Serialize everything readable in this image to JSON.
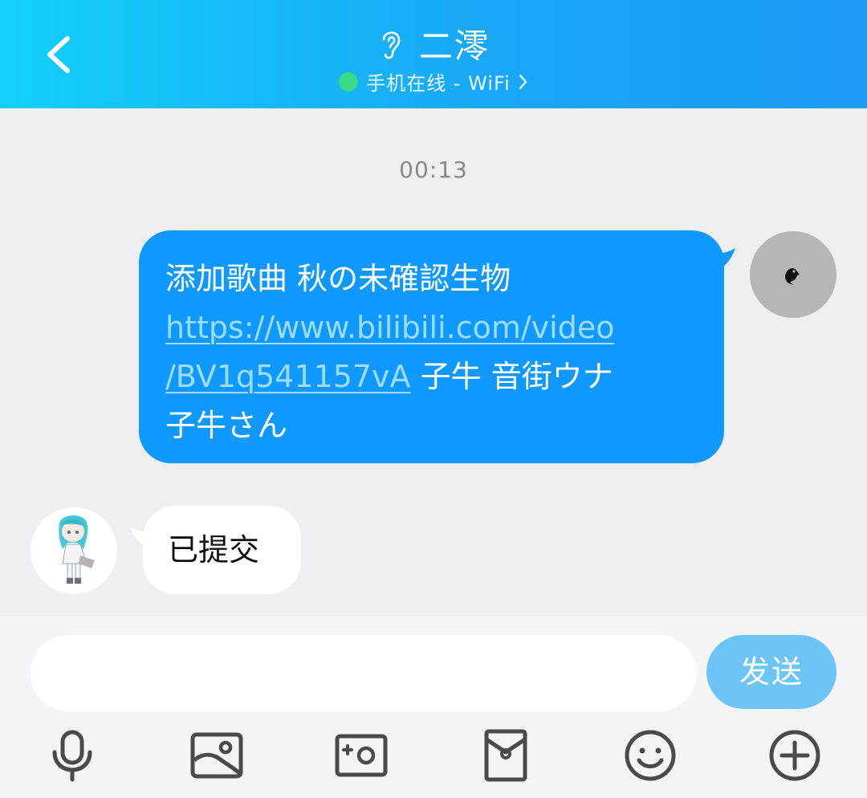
{
  "header": {
    "contact_name": "二澪",
    "status_text": "手机在线 - WiFi",
    "status_color": "#3bd98a",
    "accent": "#1a9bf6",
    "icons": [
      "back-arrow-icon",
      "ear-icon",
      "chevron-right-icon"
    ]
  },
  "chat": {
    "timestamp": "00:13",
    "messages": [
      {
        "sender": "self",
        "bubble_color": "#0f99ff",
        "text_before_link": "添加歌曲 秋の未確認生物",
        "link_line1": "https://www.bilibili.com/video",
        "link_line2": "/BV1q541157vA",
        "text_after_link": " 子牛 音街ウナ",
        "text_last_line": "子牛さん"
      },
      {
        "sender": "contact",
        "bubble_color": "#ffffff",
        "text": "已提交"
      }
    ]
  },
  "composer": {
    "input_value": "",
    "send_label": "发送",
    "send_color": "#6cc4f7",
    "toolbar_icons": [
      "microphone-icon",
      "image-icon",
      "camera-icon",
      "red-packet-icon",
      "emoji-icon",
      "plus-icon"
    ]
  }
}
